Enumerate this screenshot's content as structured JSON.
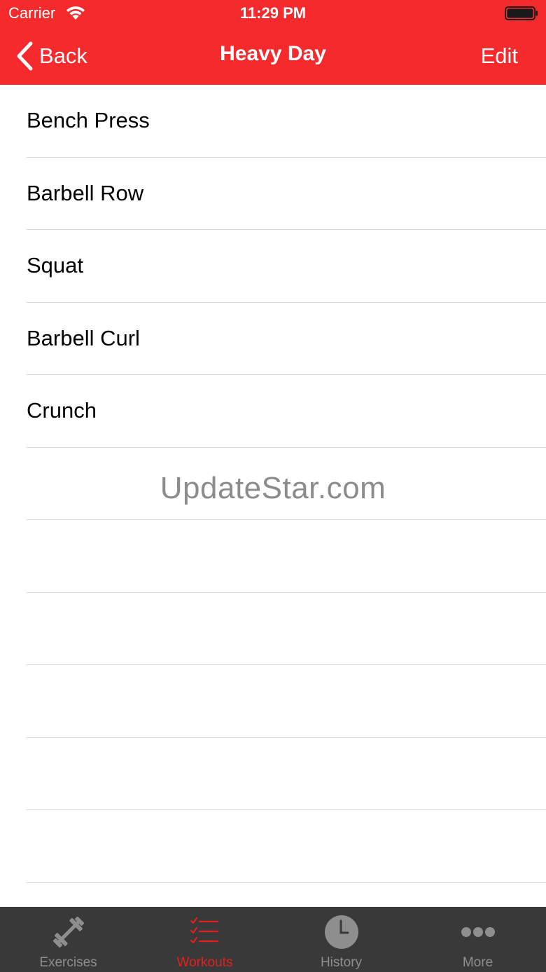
{
  "status": {
    "carrier": "Carrier",
    "time": "11:29 PM"
  },
  "nav": {
    "back_label": "Back",
    "title": "Heavy Day",
    "edit_label": "Edit"
  },
  "exercises": [
    {
      "name": "Bench Press"
    },
    {
      "name": "Barbell Row"
    },
    {
      "name": "Squat"
    },
    {
      "name": "Barbell Curl"
    },
    {
      "name": "Crunch"
    }
  ],
  "watermark": "UpdateStar.com",
  "tabs": [
    {
      "label": "Exercises",
      "icon": "barbell-icon"
    },
    {
      "label": "Workouts",
      "icon": "checklist-icon"
    },
    {
      "label": "History",
      "icon": "clock-icon"
    },
    {
      "label": "More",
      "icon": "more-dots-icon"
    }
  ],
  "active_tab": "Workouts",
  "colors": {
    "header": "#f52a2d",
    "tab_bar": "#393939",
    "tab_active": "#e02020",
    "tab_inactive": "#8e8e8e"
  }
}
